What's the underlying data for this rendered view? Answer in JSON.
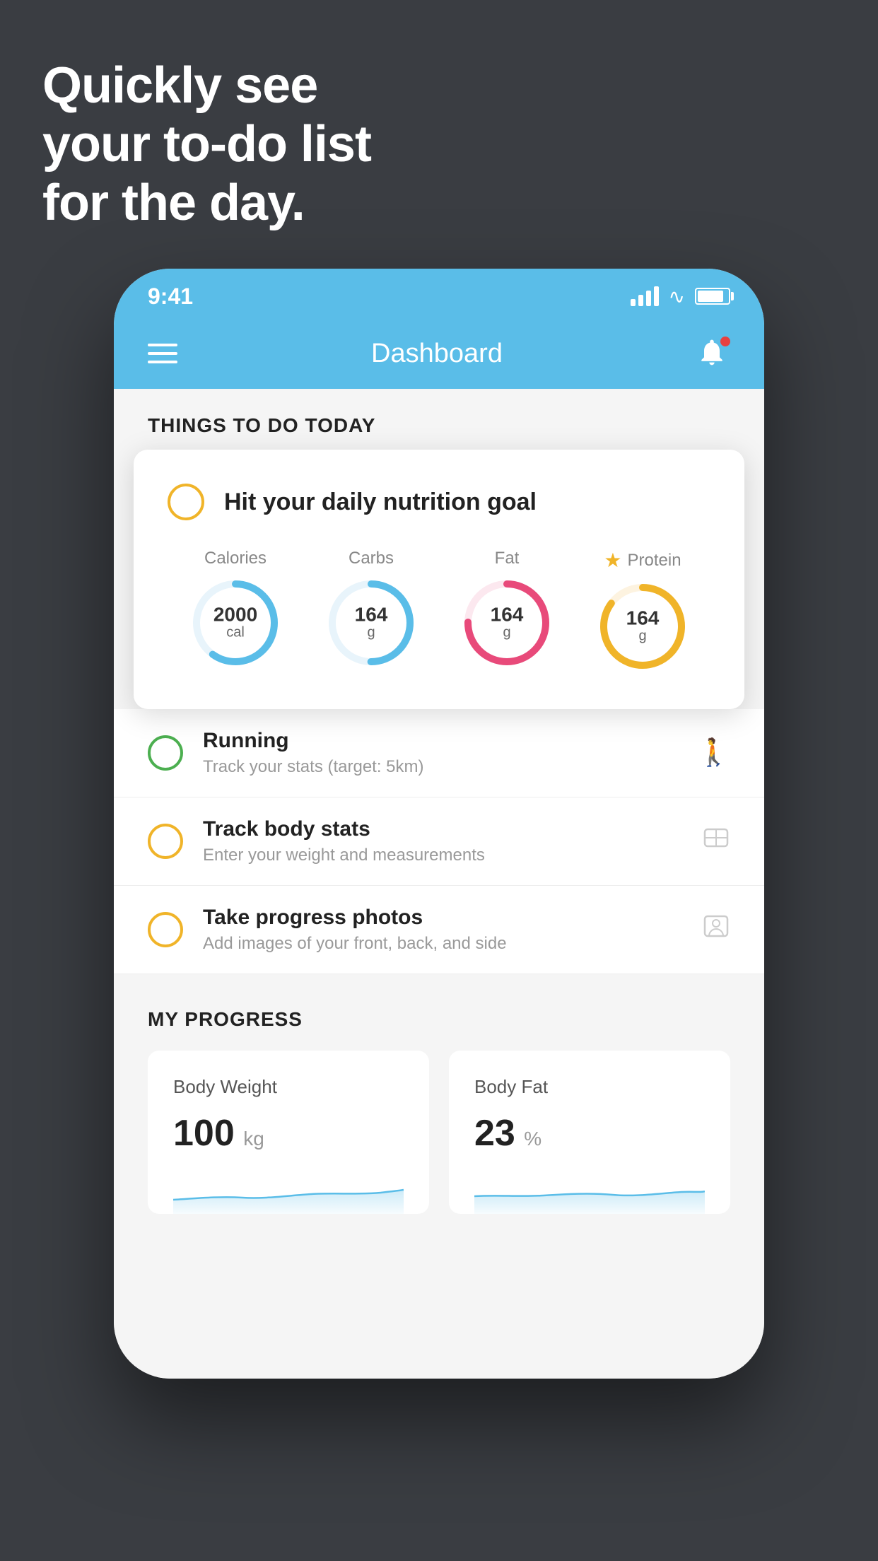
{
  "headline": {
    "line1": "Quickly see",
    "line2": "your to-do list",
    "line3": "for the day."
  },
  "status_bar": {
    "time": "9:41"
  },
  "nav": {
    "title": "Dashboard"
  },
  "things_section": {
    "title": "THINGS TO DO TODAY"
  },
  "nutrition_card": {
    "title": "Hit your daily nutrition goal",
    "items": [
      {
        "label": "Calories",
        "value": "2000",
        "unit": "cal",
        "color": "#5abde8",
        "track_percent": 60
      },
      {
        "label": "Carbs",
        "value": "164",
        "unit": "g",
        "color": "#5abde8",
        "track_percent": 50
      },
      {
        "label": "Fat",
        "value": "164",
        "unit": "g",
        "color": "#e84a7a",
        "track_percent": 75
      },
      {
        "label": "Protein",
        "value": "164",
        "unit": "g",
        "color": "#f0b429",
        "track_percent": 85,
        "star": true
      }
    ]
  },
  "list_items": [
    {
      "title": "Running",
      "subtitle": "Track your stats (target: 5km)",
      "circle_color": "green",
      "icon": "shoe"
    },
    {
      "title": "Track body stats",
      "subtitle": "Enter your weight and measurements",
      "circle_color": "yellow",
      "icon": "scale"
    },
    {
      "title": "Take progress photos",
      "subtitle": "Add images of your front, back, and side",
      "circle_color": "yellow",
      "icon": "person"
    }
  ],
  "progress_section": {
    "title": "MY PROGRESS",
    "cards": [
      {
        "title": "Body Weight",
        "value": "100",
        "unit": "kg"
      },
      {
        "title": "Body Fat",
        "value": "23",
        "unit": "%"
      }
    ]
  }
}
